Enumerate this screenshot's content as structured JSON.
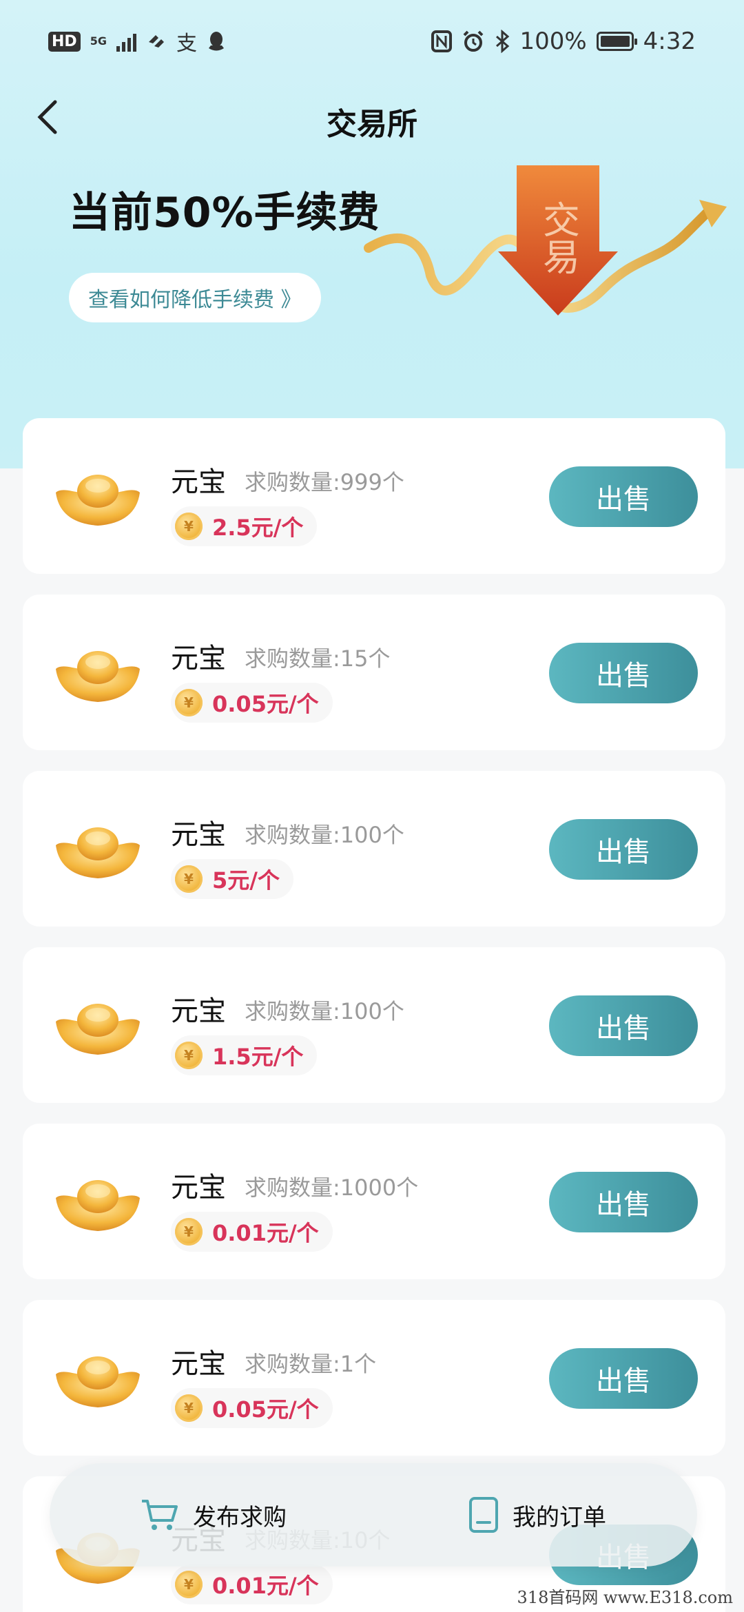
{
  "status_bar": {
    "network": "5G",
    "battery": "100%",
    "time": "4:32"
  },
  "nav": {
    "title": "交易所"
  },
  "hero": {
    "title": "当前50%手续费",
    "link": "查看如何降低手续费 》",
    "art_text": "交易"
  },
  "items": [
    {
      "name": "元宝",
      "qty": "求购数量:999个",
      "price": "2.5元/个",
      "action": "出售"
    },
    {
      "name": "元宝",
      "qty": "求购数量:15个",
      "price": "0.05元/个",
      "action": "出售"
    },
    {
      "name": "元宝",
      "qty": "求购数量:100个",
      "price": "5元/个",
      "action": "出售"
    },
    {
      "name": "元宝",
      "qty": "求购数量:100个",
      "price": "1.5元/个",
      "action": "出售"
    },
    {
      "name": "元宝",
      "qty": "求购数量:1000个",
      "price": "0.01元/个",
      "action": "出售"
    },
    {
      "name": "元宝",
      "qty": "求购数量:1个",
      "price": "0.05元/个",
      "action": "出售"
    },
    {
      "name": "元宝",
      "qty": "求购数量:10个",
      "price": "0.01元/个",
      "action": "出售"
    }
  ],
  "bottom_bar": {
    "post_request": "发布求购",
    "my_orders": "我的订单"
  },
  "watermark": "318首码网 www.E318.com",
  "icons": [
    "back-arrow-icon",
    "cart-icon",
    "order-document-icon",
    "gold-ingot-icon",
    "coin-icon"
  ],
  "colors": {
    "accent": "#4ea6b0",
    "price": "#d8345a",
    "hero_bg": "#c9f0f6"
  }
}
